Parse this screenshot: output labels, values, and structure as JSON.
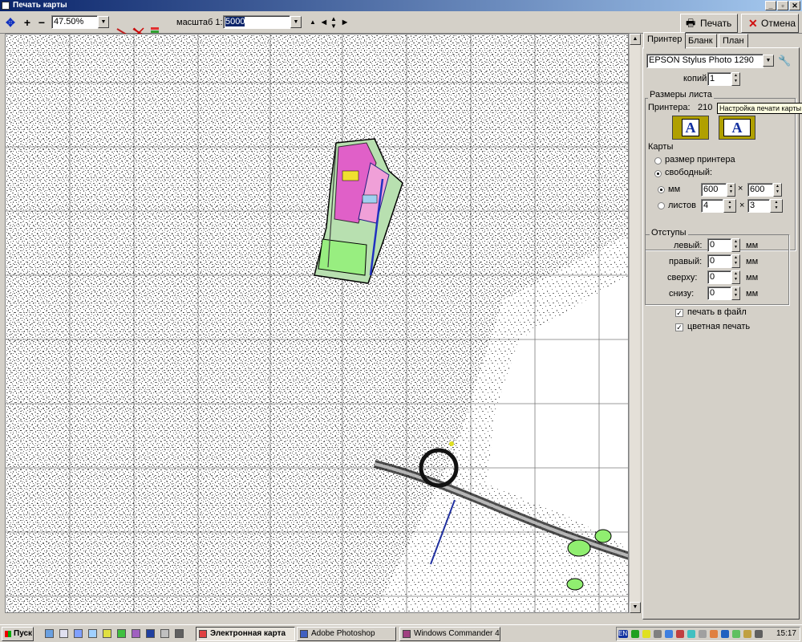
{
  "window": {
    "title": "Печать карты",
    "minimize": "_",
    "maximize": "▫",
    "close": "✕"
  },
  "toolbar": {
    "move_icon": "move-icon",
    "zoom_in": "+",
    "zoom_out": "−",
    "zoom_value": "47.50%",
    "scale_label": "масштаб 1:",
    "scale_value": "5000",
    "print_label": "Печать",
    "cancel_label": "Отмена"
  },
  "panel": {
    "tabs": [
      {
        "label": "Принтер"
      },
      {
        "label": "Бланк"
      },
      {
        "label": "План"
      }
    ],
    "printer": "EPSON Stylus Photo 1290",
    "copies_label": "копий:",
    "copies_value": "1",
    "sheet_group": "Размеры листа",
    "printer_size_label": "Принтера:",
    "printer_size_value": "210",
    "tooltip": "Настройка печати карты",
    "orientation_letter": "A",
    "maps_label": "Карты",
    "opt_printer_size": "размер принтера",
    "opt_free": "свободный:",
    "mm_label": "мм",
    "mm_w": "600",
    "mm_h": "600",
    "sheets_label": "листов",
    "sheets_w": "4",
    "sheets_h": "3",
    "x_sign": "×",
    "margins_group": "Отступы",
    "margins": [
      {
        "label": "левый:",
        "value": "0",
        "unit": "мм"
      },
      {
        "label": "правый:",
        "value": "0",
        "unit": "мм"
      },
      {
        "label": "сверху:",
        "value": "0",
        "unit": "мм"
      },
      {
        "label": "снизу:",
        "value": "0",
        "unit": "мм"
      }
    ],
    "print_to_file": "печать в файл",
    "color_print": "цветная печать"
  },
  "taskbar": {
    "start": "Пуск",
    "tasks": [
      {
        "label": "Электронная карта"
      },
      {
        "label": "Adobe Photoshop"
      },
      {
        "label": "Windows Commander 4...."
      }
    ],
    "tray_lang": "EN",
    "clock": "15:17"
  },
  "colors": {
    "accent": "#0a246a",
    "map_pink": "#e040c0",
    "map_green": "#90ee70"
  }
}
